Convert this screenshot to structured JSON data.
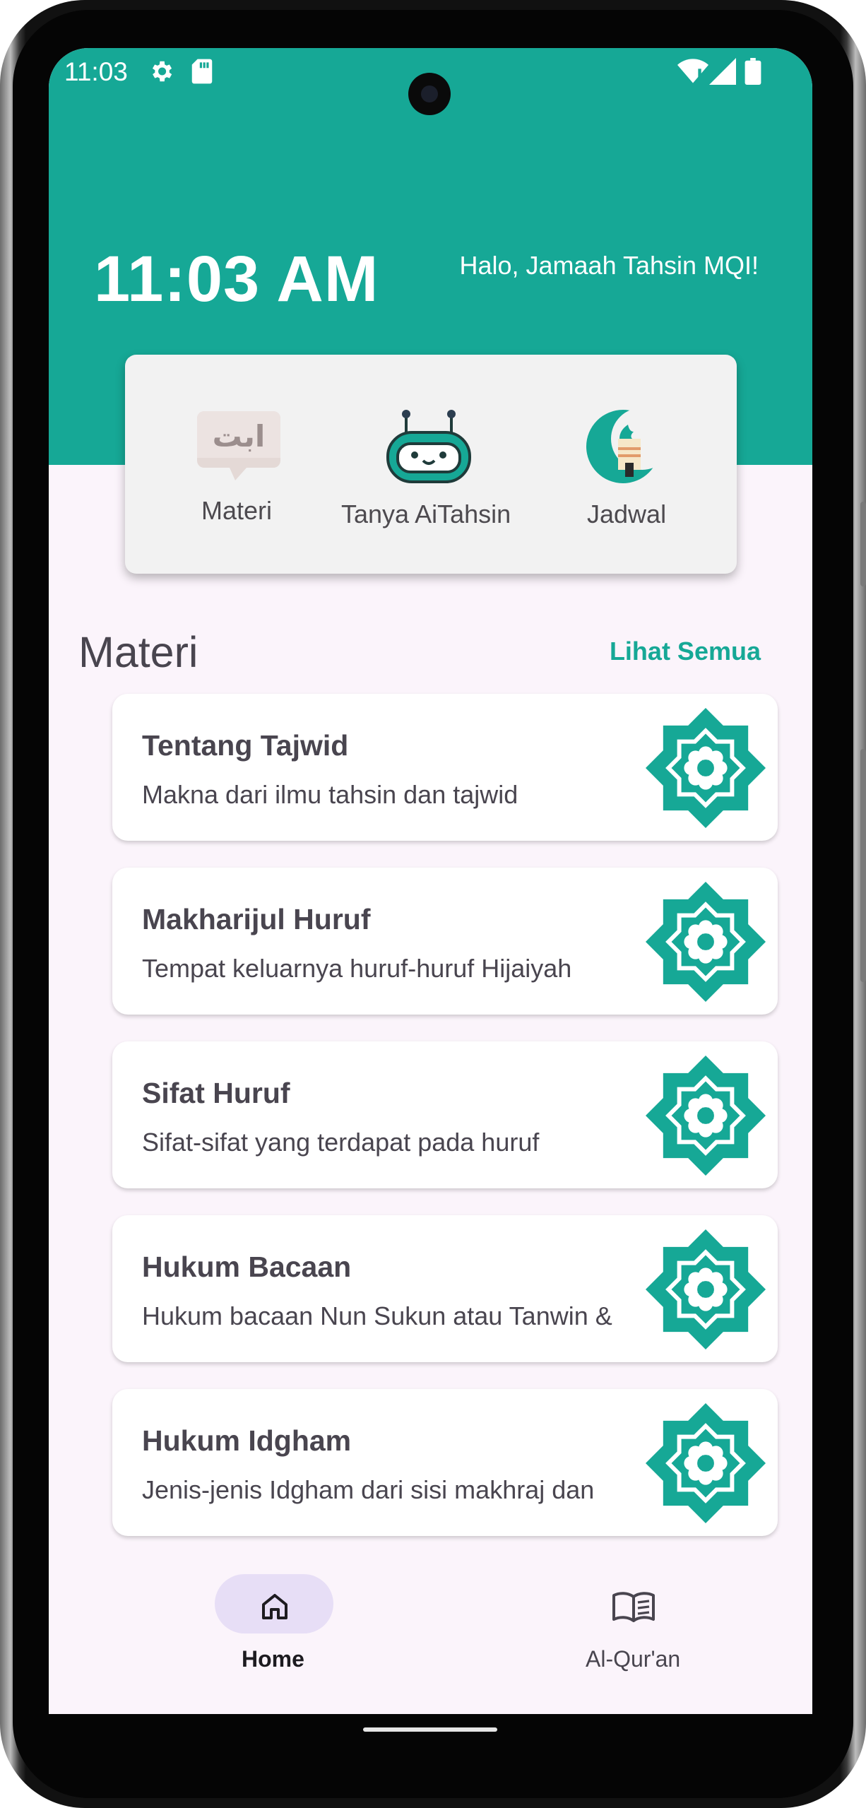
{
  "colors": {
    "primary": "#16a896",
    "background": "#fbf4fb",
    "card": "#ffffff",
    "text": "#49454f",
    "nav_indicator": "#e7def6"
  },
  "status_bar": {
    "time": "11:03",
    "left_icons": [
      "gear-icon",
      "sd-card-icon"
    ],
    "right_icons": [
      "wifi-icon",
      "signal-icon",
      "battery-icon"
    ]
  },
  "header": {
    "clock": "11:03 AM",
    "greeting": "Halo, Jamaah Tahsin MQI!"
  },
  "quick_menu": [
    {
      "label": "Materi",
      "icon": "arabic-letters-bubble-icon",
      "glyph": "ابت"
    },
    {
      "label": "Tanya AiTahsin",
      "icon": "robot-icon"
    },
    {
      "label": "Jadwal",
      "icon": "crescent-mosque-icon"
    }
  ],
  "materi": {
    "title": "Materi",
    "see_all": "Lihat Semua",
    "items": [
      {
        "title": "Tentang Tajwid",
        "desc": "Makna dari ilmu tahsin dan tajwid",
        "icon": "islamic-star-icon"
      },
      {
        "title": "Makharijul Huruf",
        "desc": "Tempat keluarnya huruf-huruf Hijaiyah",
        "icon": "islamic-star-icon"
      },
      {
        "title": "Sifat Huruf",
        "desc": "Sifat-sifat yang terdapat pada huruf",
        "icon": "islamic-star-icon"
      },
      {
        "title": "Hukum Bacaan",
        "desc": "Hukum bacaan Nun Sukun atau Tanwin &",
        "icon": "islamic-star-icon"
      },
      {
        "title": "Hukum Idgham",
        "desc": "Jenis-jenis Idgham dari sisi makhraj dan",
        "icon": "islamic-star-icon"
      }
    ]
  },
  "bottom_nav": [
    {
      "label": "Home",
      "icon": "home-icon",
      "selected": true
    },
    {
      "label": "Al-Qur'an",
      "icon": "book-icon",
      "selected": false
    }
  ]
}
